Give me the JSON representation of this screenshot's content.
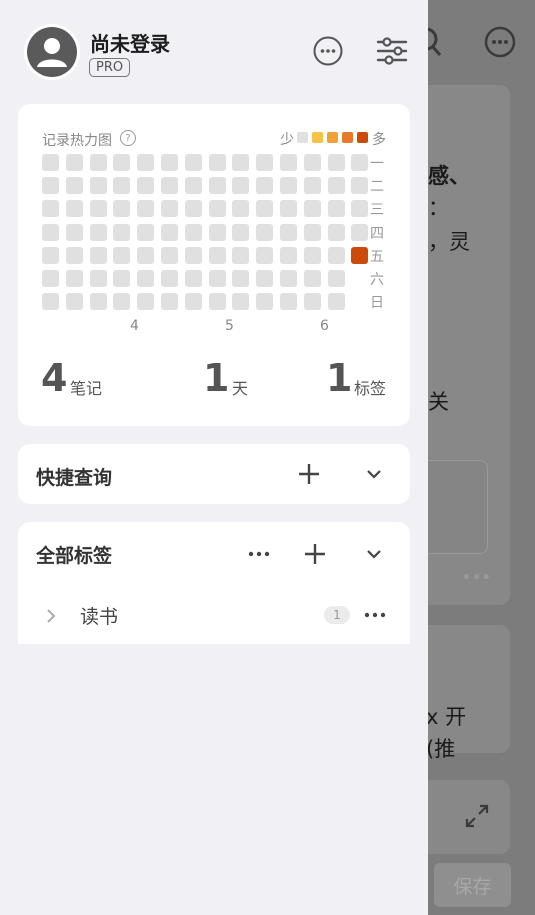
{
  "user": {
    "name": "尚未登录",
    "badge": "PRO"
  },
  "heatmap": {
    "title": "记录热力图",
    "help_glyph": "?",
    "legend_less": "少",
    "legend_more": "多",
    "legend_colors": [
      "#e0e0e0",
      "#f6c344",
      "#f2a03a",
      "#e8792a",
      "#cc4b0a"
    ],
    "day_labels": [
      "一",
      "二",
      "三",
      "四",
      "五",
      "六",
      "日"
    ],
    "week_labels": [
      "4",
      "5",
      "6"
    ],
    "active_color": "#cc4b0a",
    "active_cell": {
      "week_index": 13,
      "day": "五",
      "level": 4
    }
  },
  "stats": [
    {
      "value": "4",
      "label": "笔记"
    },
    {
      "value": "1",
      "label": "天"
    },
    {
      "value": "1",
      "label": "标签"
    }
  ],
  "quick_query": {
    "title": "快捷查询"
  },
  "tags": {
    "title": "全部标签",
    "items": [
      {
        "label": "读书",
        "count": "1"
      }
    ]
  },
  "background": {
    "lines": [
      "感、",
      "：",
      "，灵",
      "关",
      "x 开",
      "(推"
    ],
    "save_label": "保存",
    "icons": [
      "search-icon",
      "more-icon",
      "expand-icon"
    ]
  }
}
